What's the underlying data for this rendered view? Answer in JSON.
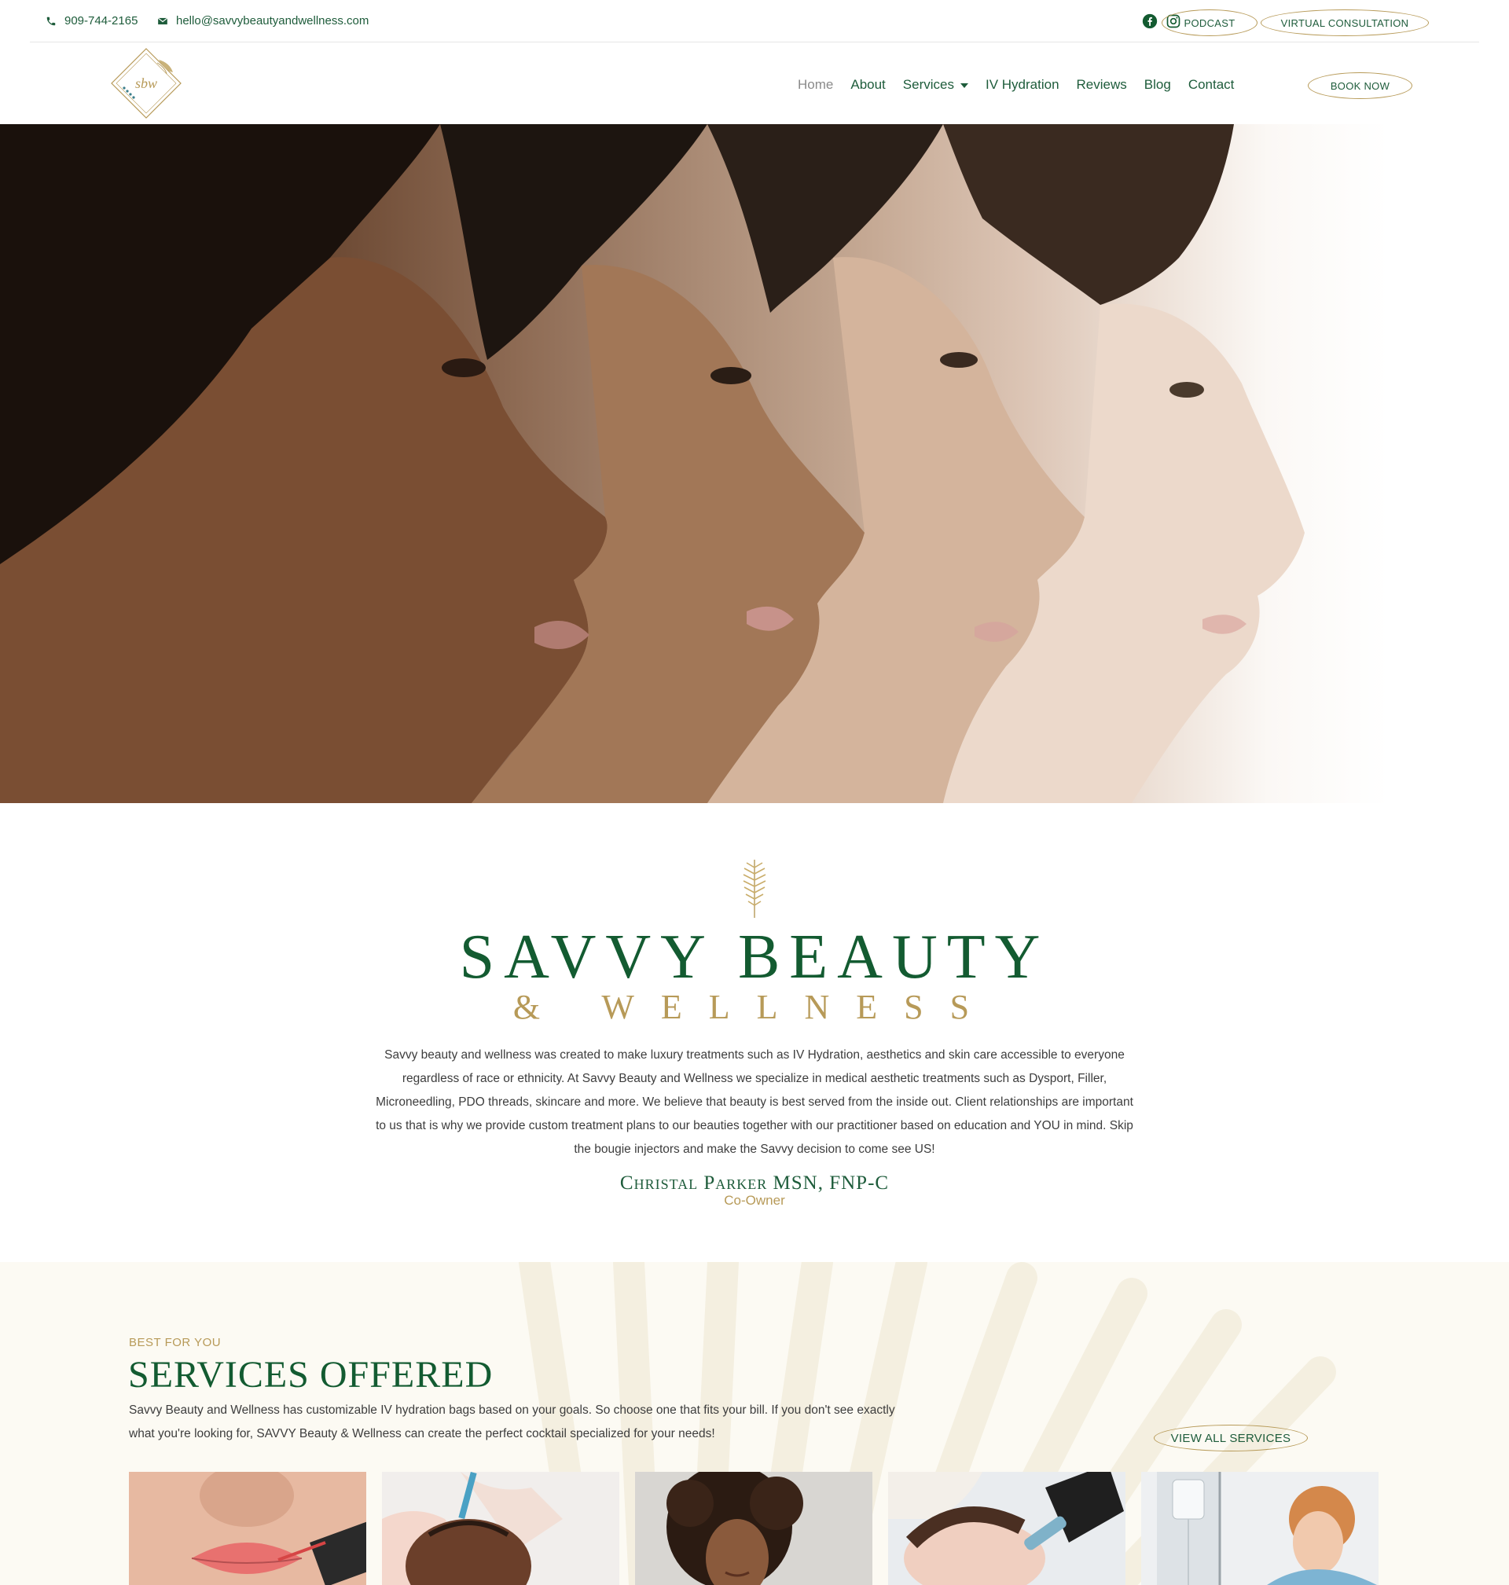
{
  "topbar": {
    "phone": "909-744-2165",
    "email": "hello@savvybeautyandwellness.com",
    "podcast_label": "PODCAST",
    "consult_label": "VIRTUAL CONSULTATION",
    "icons": [
      "phone-icon",
      "envelope-icon",
      "facebook-icon",
      "instagram-icon"
    ]
  },
  "nav": {
    "logo_text": "sbw",
    "items": [
      {
        "label": "Home",
        "active": true
      },
      {
        "label": "About"
      },
      {
        "label": "Services",
        "dropdown": true
      },
      {
        "label": "IV Hydration"
      },
      {
        "label": "Reviews"
      },
      {
        "label": "Blog"
      },
      {
        "label": "Contact"
      }
    ],
    "book_label": "BOOK NOW"
  },
  "about": {
    "brand_line1": "SAVVY BEAUTY",
    "brand_line2": "& WELLNESS",
    "paragraph": "Savvy beauty and wellness was created to make luxury treatments such as IV Hydration, aesthetics and skin care accessible to everyone regardless of race or ethnicity. At Savvy Beauty and Wellness we specialize in medical aesthetic treatments such as Dysport, Filler, Microneedling, PDO threads, skincare and more. We believe that beauty is best served from the inside out. Client relationships are important to us that is why we provide custom treatment plans to our beauties together with our practitioner based on education and YOU in mind. Skip the bougie injectors and make the Savvy decision to come see US!",
    "signature_name": "Christal Parker MSN, FNP-C",
    "signature_role": "Co-Owner"
  },
  "services": {
    "eyebrow": "BEST FOR YOU",
    "title": "SERVICES OFFERED",
    "text": "Savvy Beauty and Wellness has customizable IV hydration bags based on your goals. So choose one that fits your bill. If you don't see exactly what you're looking for, SAVVY Beauty & Wellness can create the perfect cocktail specialized for your needs!",
    "view_all_label": "VIEW ALL SERVICES"
  },
  "colors": {
    "green": "#135b31",
    "gold": "#b79a58",
    "cream": "#fcfaf3"
  }
}
